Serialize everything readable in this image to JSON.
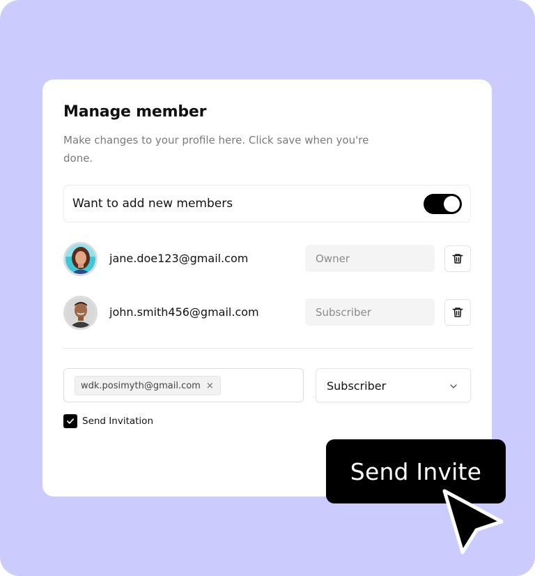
{
  "card": {
    "title": "Manage member",
    "description": "Make changes to your profile here. Click save when you're done."
  },
  "toggle": {
    "label": "Want to add new members",
    "enabled": true
  },
  "members": [
    {
      "email": "jane.doe123@gmail.com",
      "role_placeholder": "Owner",
      "avatar": "woman-avatar"
    },
    {
      "email": "john.smith456@gmail.com",
      "role_placeholder": "Subscriber",
      "avatar": "man-avatar"
    }
  ],
  "invite": {
    "chip_email": "wdk.posimyth@gmail.com",
    "chip_remove": "×",
    "role_selected": "Subscriber"
  },
  "send_invitation": {
    "label": "Send Invitation",
    "checked": true
  },
  "send_button": {
    "label": "Send Invite"
  },
  "colors": {
    "background": "#cccbfd",
    "card": "#ffffff",
    "primary": "#000000",
    "muted_text": "#7a7a7a",
    "field_bg": "#f4f4f4"
  },
  "icons": [
    "trash-icon",
    "chevron-down-icon",
    "check-icon",
    "close-icon",
    "cursor-pointer-icon"
  ]
}
